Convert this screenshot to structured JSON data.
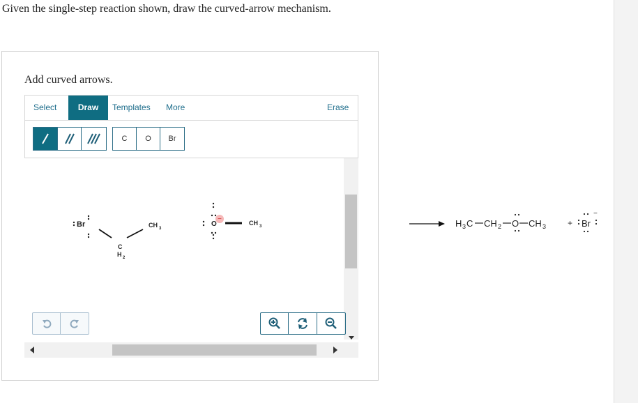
{
  "question": "Given the single-step reaction shown, draw the curved-arrow mechanism.",
  "instruction": "Add curved arrows.",
  "toolbar": {
    "tabs": [
      "Select",
      "Draw",
      "Templates",
      "More"
    ],
    "erase": "Erase"
  },
  "atoms": [
    "C",
    "O",
    "Br"
  ],
  "molecule": {
    "br": "Br",
    "ch2_c": "C",
    "ch2_h": "H",
    "ch2_sub": "2",
    "ch3_left": "CH",
    "ch3_left_sub": "3",
    "oxygen": "O",
    "charge": "−",
    "ch3_right": "CH",
    "ch3_right_sub": "3"
  },
  "product": {
    "left_c": "H",
    "left_sub": "3",
    "left_rest": "C",
    "mid": "CH",
    "mid_sub": "2",
    "o": "O",
    "right": "CH",
    "right_sub": "3",
    "plus": "+",
    "br": "Br",
    "br_charge": "−"
  },
  "colors": {
    "accent": "#0f6d82",
    "charge_bg": "#f6b9b9"
  }
}
